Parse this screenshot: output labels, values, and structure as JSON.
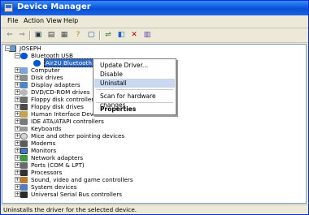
{
  "window": {
    "title": "Device Manager"
  },
  "menubar": [
    "File",
    "Action",
    "View",
    "Help"
  ],
  "toolbar": {
    "icons": [
      "back-icon",
      "forward-icon",
      "computer-icon",
      "print-icon",
      "properties-icon",
      "help-icon",
      "scan-hardware-icon",
      "update-driver-icon",
      "uninstall-icon",
      "disable-icon"
    ]
  },
  "tree": {
    "root": "JOSEPH",
    "expanded": "Bluetooth USB",
    "selected_child": "Air2U Bluetooth Device",
    "categories": [
      "Computer",
      "Disk drives",
      "Display adapters",
      "DVD/CD-ROM drives",
      "Floppy disk controllers",
      "Floppy disk drives",
      "Human Interface Devices",
      "IDE ATA/ATAPI controllers",
      "Keyboards",
      "Mice and other pointing devices",
      "Modems",
      "Monitors",
      "Network adapters",
      "Ports (COM & LPT)",
      "Processors",
      "Sound, video and game controllers",
      "System devices",
      "Universal Serial Bus controllers"
    ]
  },
  "context_menu": {
    "update_driver": "Update Driver...",
    "disable": "Disable",
    "uninstall": "Uninstall",
    "scan": "Scan for hardware changes",
    "properties": "Properties"
  },
  "status": "Uninstalls the driver for the selected device.",
  "colors": {
    "titlebar": "#0b5ce0",
    "selection": "#316ac5",
    "menu_hover": "#c9d7ef"
  }
}
